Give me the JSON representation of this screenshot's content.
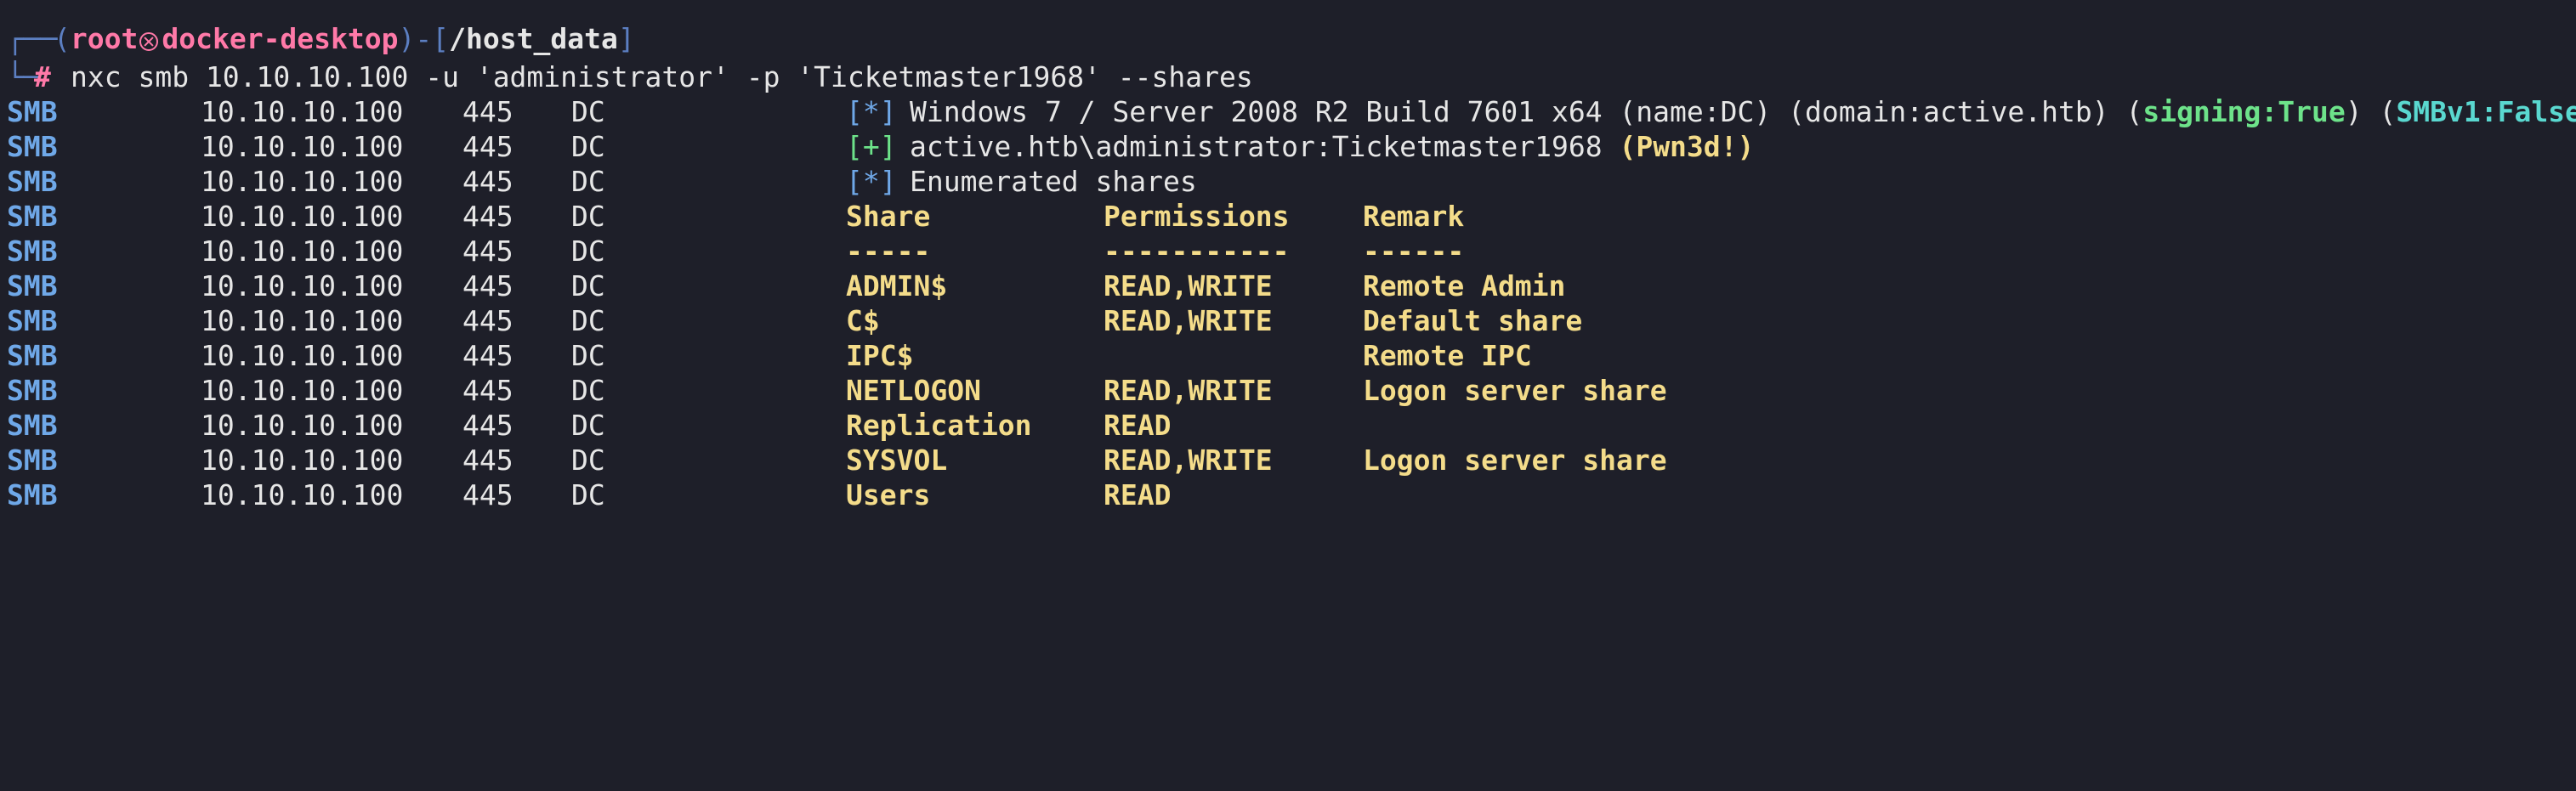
{
  "colors": {
    "background": "#1e1f29",
    "protocol_blue": "#6fa8e8",
    "prompt_pink": "#ff79a8",
    "success_green": "#6de38a",
    "highlight_yellow": "#f4dc8a",
    "cyan": "#5ad8d0"
  },
  "prompt": {
    "open_paren": "(",
    "user": "root",
    "skull_icon": "skull-icon",
    "host": "docker-desktop",
    "close_paren": ")",
    "dash": "-",
    "open_bracket": "[",
    "path": "/host_data",
    "close_bracket": "]",
    "hash": "#",
    "command": "nxc smb 10.10.10.100 -u 'administrator' -p 'Ticketmaster1968' --shares"
  },
  "rows": [
    {
      "proto": "SMB",
      "ip": "10.10.10.100",
      "port": "445",
      "name": "DC"
    },
    {
      "proto": "SMB",
      "ip": "10.10.10.100",
      "port": "445",
      "name": "DC"
    },
    {
      "proto": "SMB",
      "ip": "10.10.10.100",
      "port": "445",
      "name": "DC"
    },
    {
      "proto": "SMB",
      "ip": "10.10.10.100",
      "port": "445",
      "name": "DC"
    },
    {
      "proto": "SMB",
      "ip": "10.10.10.100",
      "port": "445",
      "name": "DC"
    },
    {
      "proto": "SMB",
      "ip": "10.10.10.100",
      "port": "445",
      "name": "DC"
    },
    {
      "proto": "SMB",
      "ip": "10.10.10.100",
      "port": "445",
      "name": "DC"
    },
    {
      "proto": "SMB",
      "ip": "10.10.10.100",
      "port": "445",
      "name": "DC"
    },
    {
      "proto": "SMB",
      "ip": "10.10.10.100",
      "port": "445",
      "name": "DC"
    },
    {
      "proto": "SMB",
      "ip": "10.10.10.100",
      "port": "445",
      "name": "DC"
    },
    {
      "proto": "SMB",
      "ip": "10.10.10.100",
      "port": "445",
      "name": "DC"
    },
    {
      "proto": "SMB",
      "ip": "10.10.10.100",
      "port": "445",
      "name": "DC"
    }
  ],
  "info_line": {
    "tag": "[*]",
    "text": "Windows 7 / Server 2008 R2 Build 7601 x64 (name:DC) (domain:active.htb) (",
    "signing": "signing:True",
    "between": ") (",
    "smbv1": "SMBv1:False",
    "end": ")"
  },
  "auth_line": {
    "tag": "[+]",
    "text": "active.htb\\administrator:Ticketmaster1968",
    "pwned": "(Pwn3d!)"
  },
  "enum_line": {
    "tag": "[*]",
    "text": "Enumerated shares"
  },
  "share_table": {
    "headers": [
      "Share",
      "Permissions",
      "Remark"
    ],
    "separators": [
      "-----",
      "-----------",
      "------"
    ],
    "shares": [
      {
        "share": "ADMIN$",
        "permissions": "READ,WRITE",
        "remark": "Remote Admin"
      },
      {
        "share": "C$",
        "permissions": "READ,WRITE",
        "remark": "Default share"
      },
      {
        "share": "IPC$",
        "permissions": "",
        "remark": "Remote IPC"
      },
      {
        "share": "NETLOGON",
        "permissions": "READ,WRITE",
        "remark": "Logon server share"
      },
      {
        "share": "Replication",
        "permissions": "READ",
        "remark": ""
      },
      {
        "share": "SYSVOL",
        "permissions": "READ,WRITE",
        "remark": "Logon server share"
      },
      {
        "share": "Users",
        "permissions": "READ",
        "remark": ""
      }
    ]
  }
}
